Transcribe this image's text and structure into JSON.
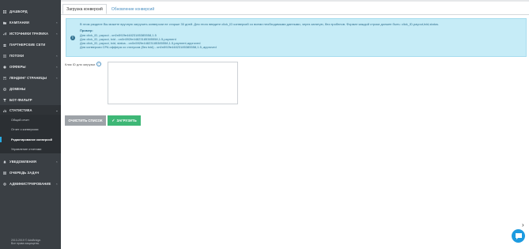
{
  "sidebar": {
    "items": [
      {
        "label": "ДАШБОРД",
        "icon": "dashboard-icon",
        "chevron": ""
      },
      {
        "label": "КАМПАНИИ",
        "icon": "folder-icon",
        "chevron": "‹"
      },
      {
        "label": "ИСТОЧНИКИ ТРАФИКА",
        "icon": "traffic-icon",
        "chevron": "‹"
      },
      {
        "label": "ПАРТНЕРСКИЕ СЕТИ",
        "icon": "network-icon",
        "chevron": ""
      },
      {
        "label": "ПОТОКИ",
        "icon": "stream-icon",
        "chevron": "‹"
      },
      {
        "label": "ОФФЕРЫ",
        "icon": "offer-icon",
        "chevron": "‹"
      },
      {
        "label": "ЛЕНДИНГ СТРАНИЦЫ",
        "icon": "landing-icon",
        "chevron": "‹"
      },
      {
        "label": "ДОМЕНЫ",
        "icon": "globe-icon",
        "chevron": ""
      },
      {
        "label": "БОТ-ФИЛЬТР",
        "icon": "filter-icon",
        "chevron": ""
      },
      {
        "label": "СТАТИСТИКА",
        "icon": "chart-icon",
        "chevron": "⌄"
      },
      {
        "label": "УВЕДОМЛЕНИЯ",
        "icon": "bell-icon",
        "chevron": "‹"
      },
      {
        "label": "ОЧЕРЕДЬ ЗАДАЧ",
        "icon": "queue-icon",
        "chevron": ""
      },
      {
        "label": "АДМИНИСТРИРОВАНИЕ",
        "icon": "gear-icon",
        "chevron": "‹"
      }
    ],
    "submenu": [
      "Общий отчет",
      "Отчет о конверсиях",
      "Редактирование конверсий",
      "Управление отчетами"
    ],
    "footer_line1": "2013-2019 © AdsBridge.",
    "footer_line2": "Все права защищены."
  },
  "tabs": {
    "active": "Загрузка конверсий",
    "inactive": "Обновление конверсий"
  },
  "info": {
    "line1": "В этом разделе Вы можете вручную загрузить конверсии не старше 30 дней. Для этого введите click_ID конверсий со всеми необходимыми данными, через запятую, без пробелов. Формат каждой строки должен быть: click_ID,payout,txid,status.",
    "example_title": "Пример:",
    "ex1": "Для click_ID, payout - on0n592fe44823185385558,1.5",
    "ex2": "Для click_ID, payout, txid - on0n592fe44823185385558,1.5,payment",
    "ex3": "Для click_ID, payout, txid, status - on0n592fe44823185385558,1.5,payment,approved",
    "ex4": "Для конверсии CPA оффера со статусом (без txid) - on0n592fe44823185385558,1.5,,approved"
  },
  "form": {
    "label": "Клик ID для загрузки",
    "help": "?",
    "textarea_value": ""
  },
  "buttons": {
    "clear": "ОЧИСТИТЬ СПИСОК",
    "upload": "ЗАГРУЗИТЬ",
    "upload_check": "✓"
  },
  "colors": {
    "sidebar": "#3a3f44",
    "accent": "#28a9e1",
    "info_bg": "#c6ecf7",
    "upload": "#3eb776",
    "clear": "#9ea3a8",
    "chat": "#1d9be0"
  }
}
